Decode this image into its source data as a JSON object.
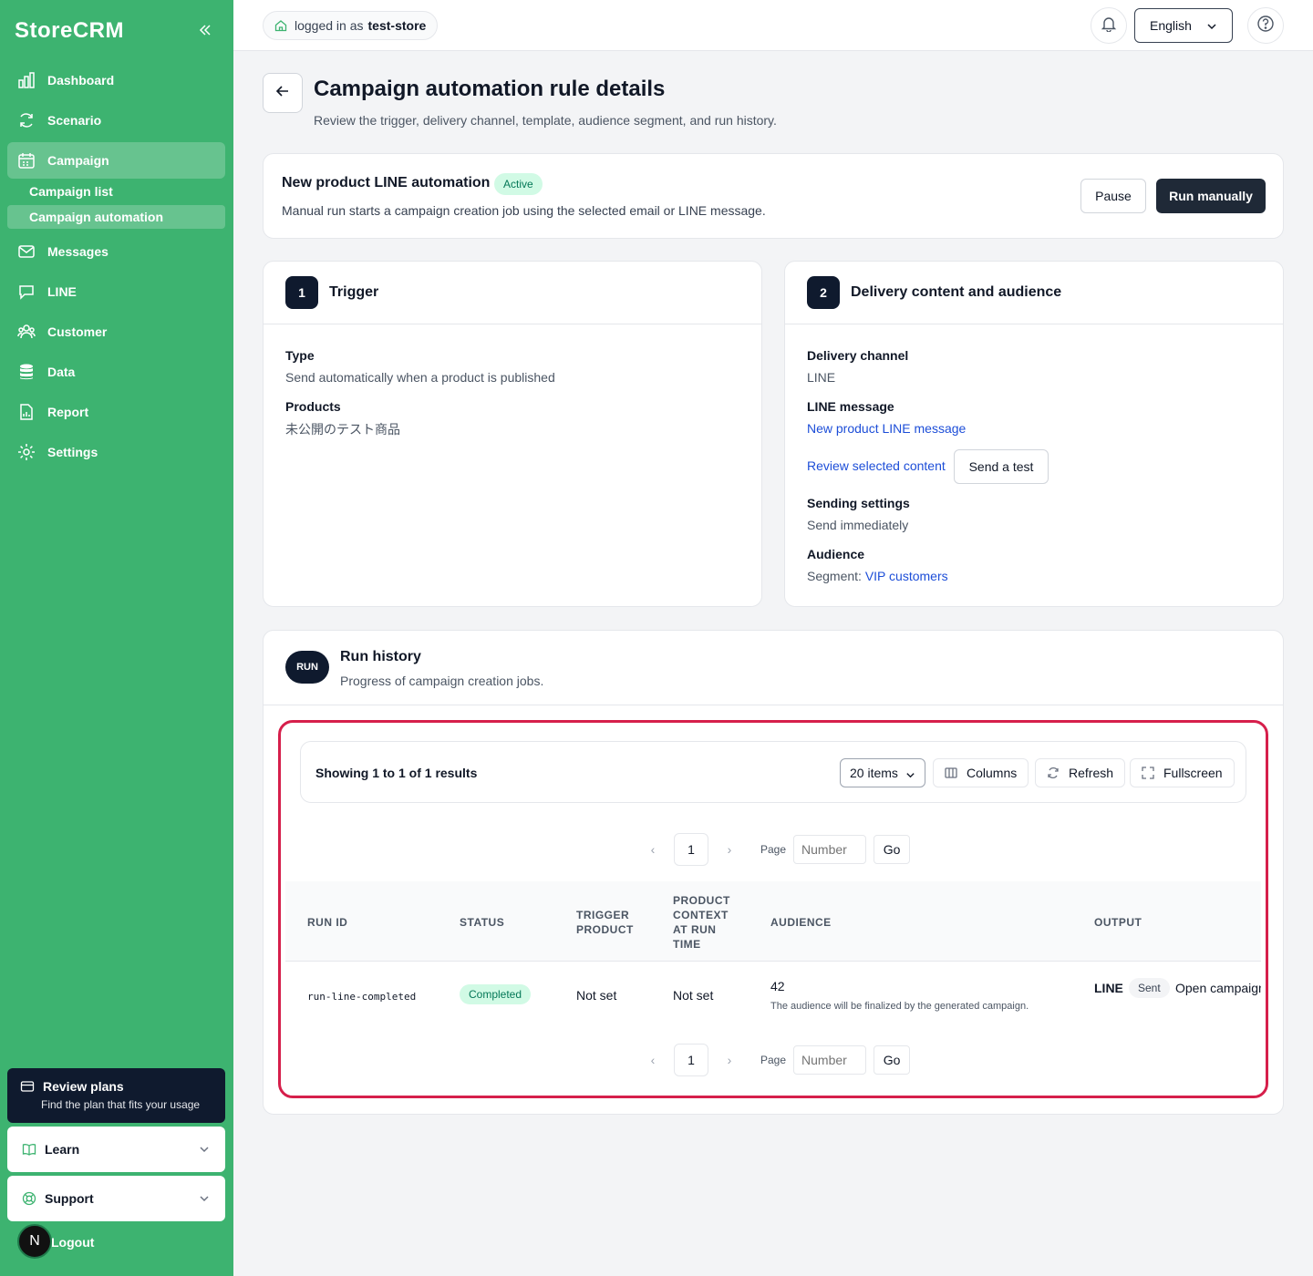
{
  "app": {
    "brand": "StoreCRM"
  },
  "sidebar": {
    "items": [
      {
        "label": "Dashboard",
        "icon": "bar-chart-icon"
      },
      {
        "label": "Scenario",
        "icon": "refresh-icon"
      },
      {
        "label": "Campaign",
        "icon": "calendar-icon",
        "active": true
      },
      {
        "label": "Messages",
        "icon": "mail-icon"
      },
      {
        "label": "LINE",
        "icon": "chat-icon"
      },
      {
        "label": "Customer",
        "icon": "users-icon"
      },
      {
        "label": "Data",
        "icon": "database-icon"
      },
      {
        "label": "Report",
        "icon": "report-icon"
      },
      {
        "label": "Settings",
        "icon": "gear-icon"
      }
    ],
    "sub_items": [
      {
        "label": "Campaign list"
      },
      {
        "label": "Campaign automation",
        "active": true
      }
    ],
    "review_plans": {
      "title": "Review plans",
      "subtitle": "Find the plan that fits your usage"
    },
    "learn": "Learn",
    "support": "Support",
    "logout": "Logout",
    "avatar_initial": "N"
  },
  "topbar": {
    "login_prefix": "logged in as",
    "store": "test-store",
    "language": "English"
  },
  "page": {
    "title": "Campaign automation rule details",
    "subtitle": "Review the trigger, delivery channel, template, audience segment, and run history."
  },
  "summary": {
    "rule_name": "New product LINE automation",
    "status": "Active",
    "description": "Manual run starts a campaign creation job using the selected email or LINE message.",
    "pause_label": "Pause",
    "run_label": "Run manually"
  },
  "trigger": {
    "step": "1",
    "title": "Trigger",
    "type_label": "Type",
    "type_value": "Send automatically when a product is published",
    "products_label": "Products",
    "products_value": "未公開のテスト商品"
  },
  "delivery": {
    "step": "2",
    "title": "Delivery content and audience",
    "channel_label": "Delivery channel",
    "channel_value": "LINE",
    "message_label": "LINE message",
    "message_value": "New product LINE message",
    "review_link": "Review selected content",
    "send_test": "Send a test",
    "sending_label": "Sending settings",
    "sending_value": "Send immediately",
    "audience_label": "Audience",
    "segment_prefix": "Segment:",
    "segment_value": "VIP customers"
  },
  "history": {
    "badge": "RUN",
    "title": "Run history",
    "subtitle": "Progress of campaign creation jobs.",
    "showing": "Showing 1 to 1 of 1 results",
    "page_size": "20 items",
    "columns_btn": "Columns",
    "refresh_btn": "Refresh",
    "fullscreen_btn": "Fullscreen",
    "pager": {
      "page": "1",
      "page_label": "Page",
      "placeholder": "Number",
      "go": "Go"
    },
    "columns": [
      "Run ID",
      "Status",
      "Trigger product",
      "Product context at run time",
      "Audience",
      "Output"
    ],
    "rows": [
      {
        "run_id": "run-line-completed",
        "status": "Completed",
        "trigger_product": "Not set",
        "product_context": "Not set",
        "audience_count": "42",
        "audience_note": "The audience will be finalized by the generated campaign.",
        "output_channel": "LINE",
        "output_status": "Sent",
        "output_link": "Open campaign"
      }
    ]
  }
}
